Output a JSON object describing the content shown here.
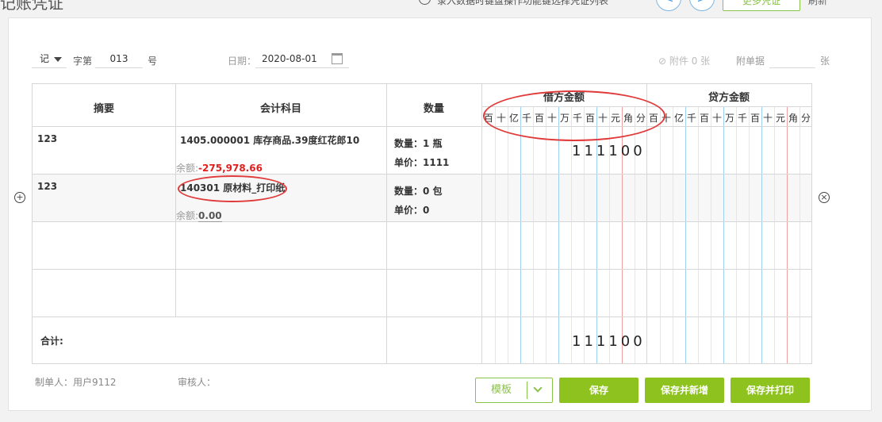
{
  "topbar": {
    "page_title": "记账凭证",
    "hint_text": "录入数据时键盘操作功能键选择凭证列表",
    "prev_label": "<",
    "next_label": ">",
    "more_label": "更多凭证",
    "refresh_label": "刷新"
  },
  "header": {
    "voucher_type": "记",
    "word_label": "字第",
    "number": "013",
    "number_suffix": "号",
    "date_label": "日期：",
    "date_value": "2020-08-01",
    "attachment_label": "附件 0 张",
    "attach_doc_label": "附单据",
    "attach_doc_value": "",
    "attach_unit": "张"
  },
  "table": {
    "headers": {
      "summary": "摘要",
      "account": "会计科目",
      "quantity": "数量",
      "debit": "借方金额",
      "credit": "贷方金额"
    },
    "digit_units": [
      "百",
      "十",
      "亿",
      "千",
      "百",
      "十",
      "万",
      "千",
      "百",
      "十",
      "元",
      "角",
      "分"
    ],
    "rows": [
      {
        "summary": "123",
        "account": "1405.000001 库存商品.39度红花郎10",
        "balance_label": "余额:",
        "balance_value": "-275,978.66",
        "qty_line": "数量：1 瓶",
        "price_line": "单价：1111",
        "debit": "111100",
        "credit": ""
      },
      {
        "summary": "123",
        "account": "140301 原材料_打印纸",
        "balance_label": "余额:",
        "balance_value": "0.00",
        "qty_line": "数量：0 包",
        "price_line": "单价：0",
        "debit": "",
        "credit": ""
      }
    ],
    "total_label": "合计:",
    "total_debit": "111100",
    "total_credit": ""
  },
  "footer": {
    "maker_label": "制单人：用户9112",
    "reviewer_label": "审核人：",
    "template_label": "模板",
    "save_label": "保存",
    "save_new_label": "保存并新增",
    "save_print_label": "保存并打印"
  },
  "colors": {
    "accent_green": "#8dc21f",
    "annotation_red": "#e03a3a",
    "negative_red": "#e02020"
  }
}
